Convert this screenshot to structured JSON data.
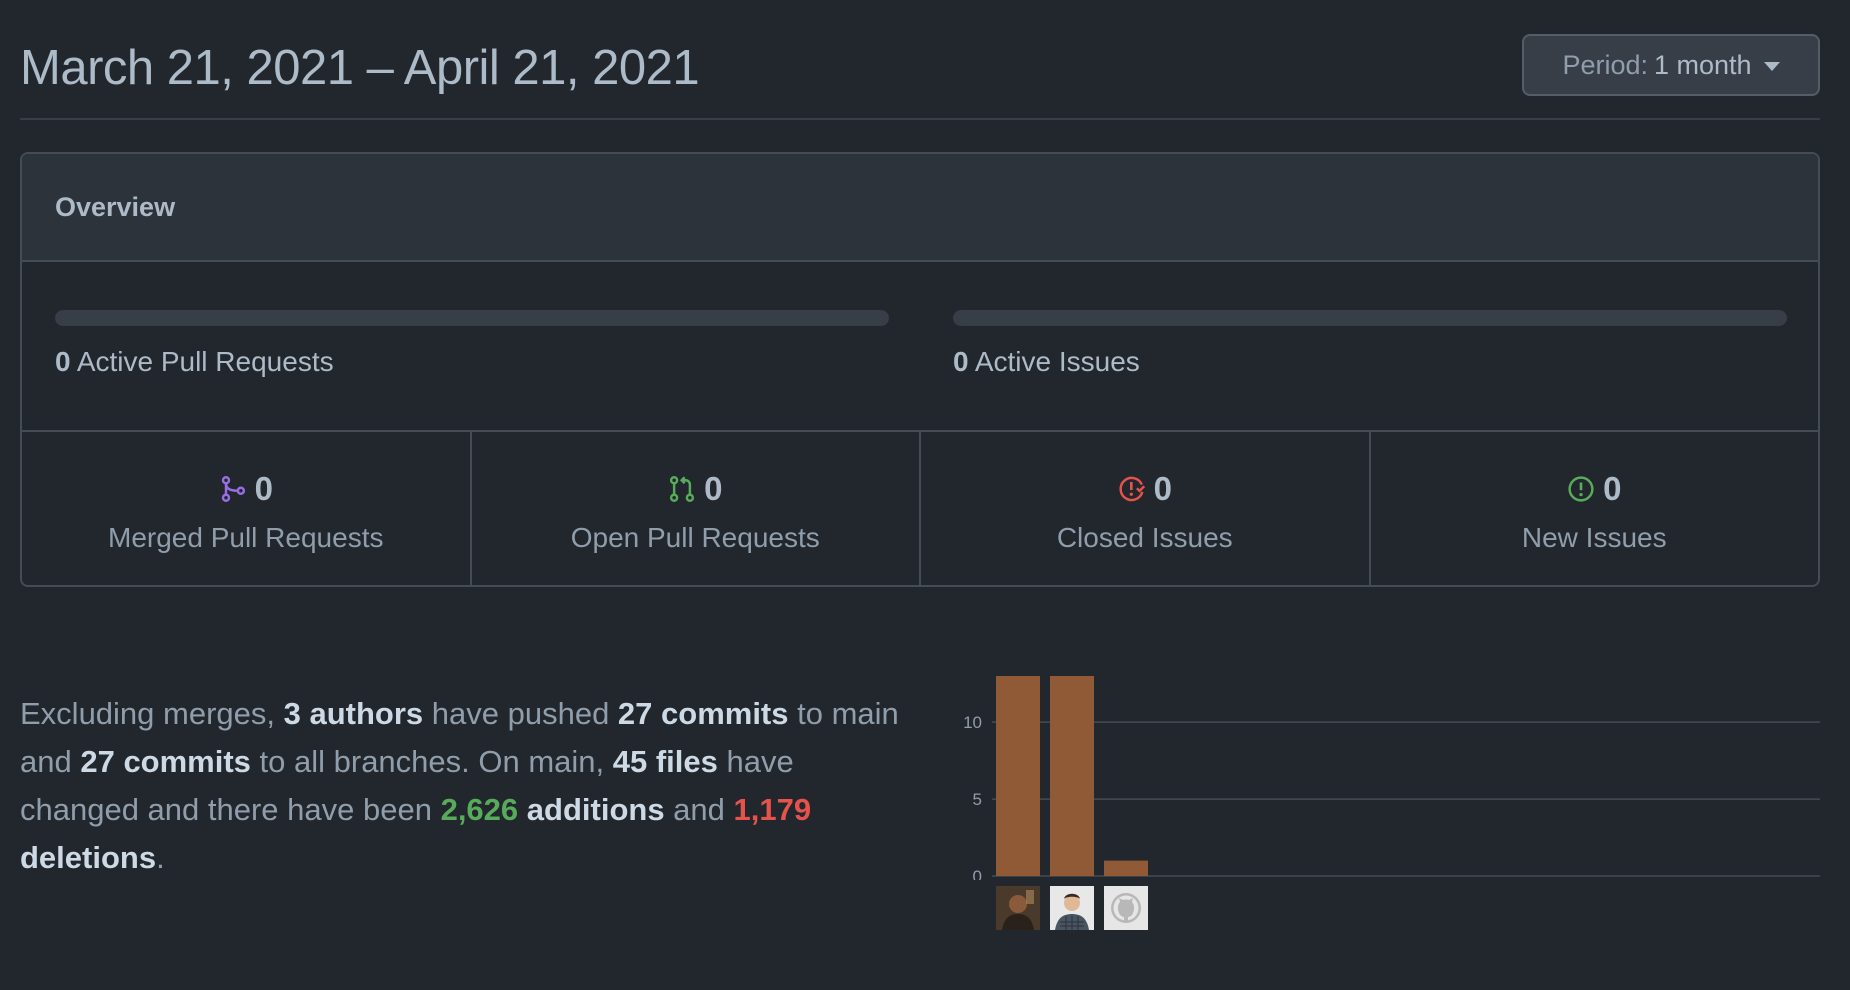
{
  "header": {
    "date_range": "March 21, 2021 – April 21, 2021",
    "period_prefix": "Period:",
    "period_value": "1 month"
  },
  "overview": {
    "title": "Overview",
    "active_pull_requests": {
      "count": "0",
      "label": "Active Pull Requests",
      "progress": 0
    },
    "active_issues": {
      "count": "0",
      "label": "Active Issues",
      "progress": 0
    },
    "stats": [
      {
        "count": "0",
        "label": "Merged Pull Requests",
        "icon": "git-merge-icon",
        "color": "#986ee2"
      },
      {
        "count": "0",
        "label": "Open Pull Requests",
        "icon": "git-pull-request-icon",
        "color": "#57ab5a"
      },
      {
        "count": "0",
        "label": "Closed Issues",
        "icon": "issue-closed-icon",
        "color": "#e5534b"
      },
      {
        "count": "0",
        "label": "New Issues",
        "icon": "issue-opened-icon",
        "color": "#57ab5a"
      }
    ]
  },
  "summary": {
    "t1": "Excluding merges, ",
    "authors": "3 authors",
    "t2": " have pushed ",
    "commits_main": "27 commits",
    "t3": " to main and ",
    "commits_all": "27 commits",
    "t4": " to all branches. On main, ",
    "files": "45 files",
    "t5": " have changed and there have been ",
    "additions_num": "2,626",
    "additions_word": "additions",
    "t6": " and ",
    "deletions_num": "1,179",
    "deletions_word": "deletions",
    "t7": "."
  },
  "chart_data": {
    "type": "bar",
    "categories": [
      "author-1",
      "author-2",
      "author-3"
    ],
    "values": [
      13,
      13,
      1
    ],
    "yticks": [
      0,
      5,
      10
    ],
    "ylim": [
      0,
      13
    ],
    "bar_color": "#8f5a35",
    "grid": true
  }
}
